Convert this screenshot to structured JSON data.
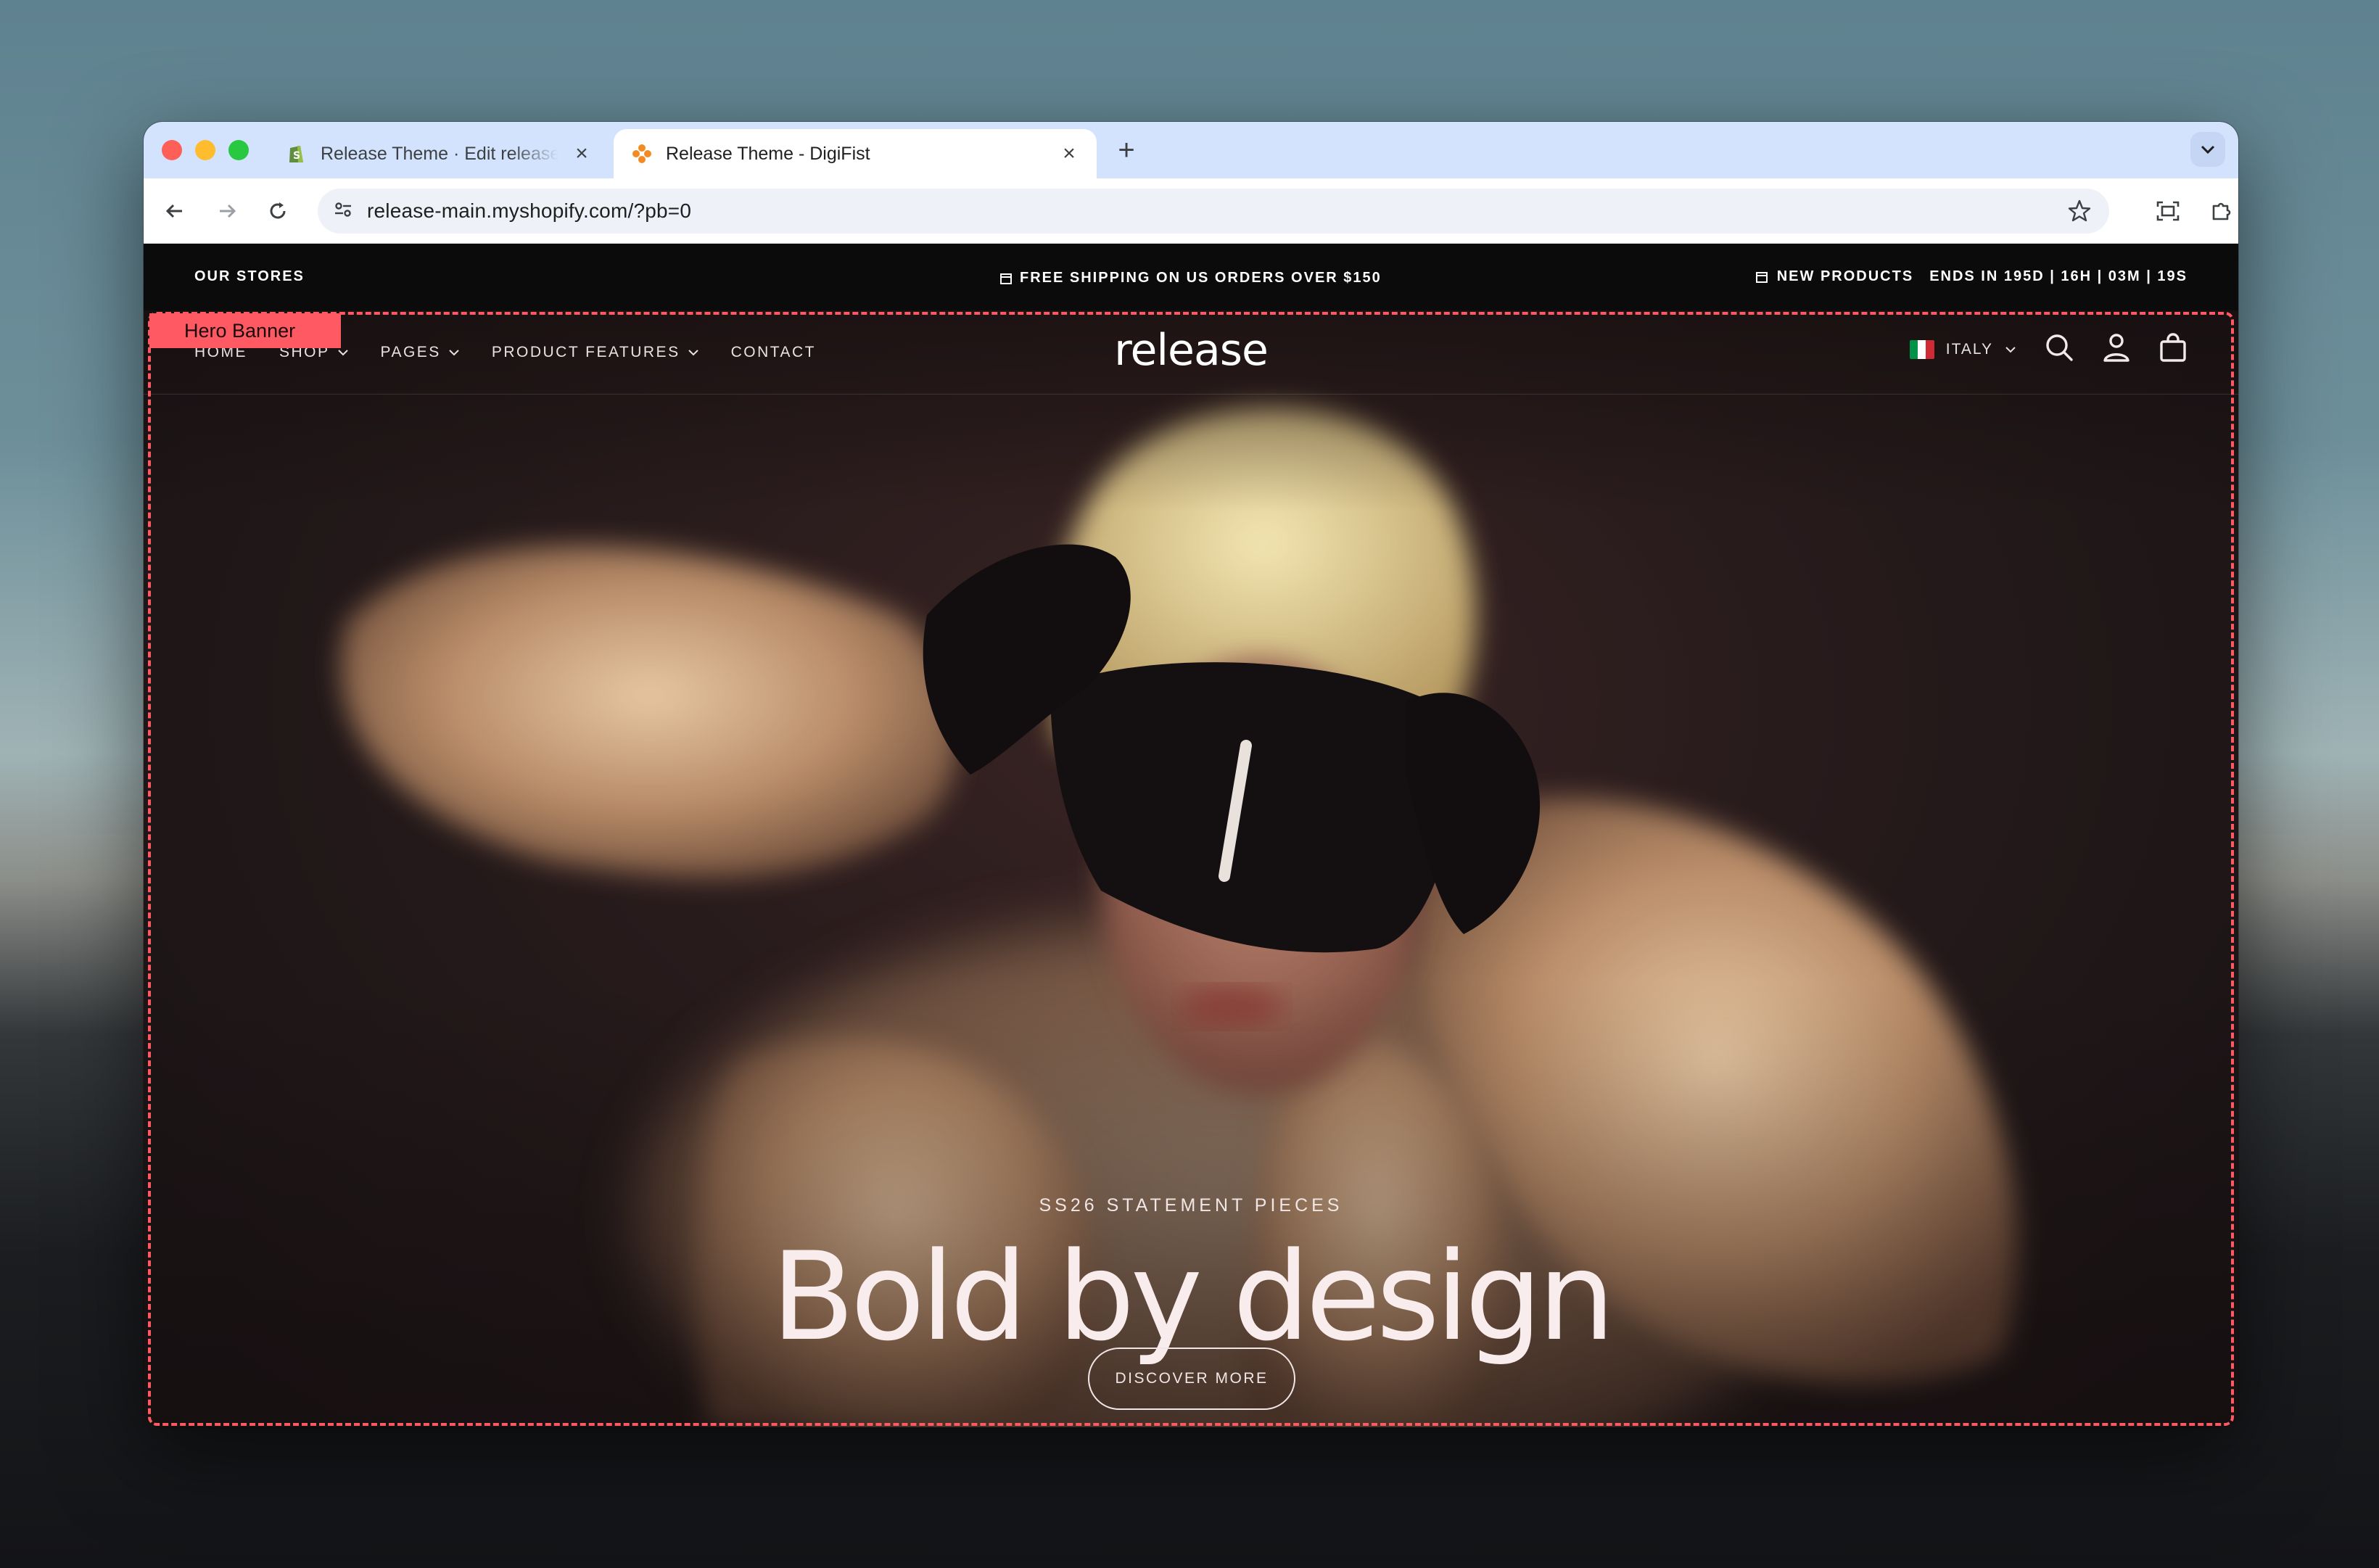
{
  "browser": {
    "tabs": [
      {
        "title": "Release Theme · Edit release",
        "active": false,
        "close": "×",
        "icon": "shopify-icon"
      },
      {
        "title": "Release Theme - DigiFist",
        "active": true,
        "close": "×",
        "icon": "digifist-icon"
      }
    ],
    "new_tab": "+",
    "url": "release-main.myshopify.com/?pb=0"
  },
  "announcement": {
    "left": "OUR STORES",
    "center": "FREE SHIPPING ON US ORDERS OVER $150",
    "right_label": "NEW PRODUCTS",
    "countdown": "ENDS IN 195D | 16H | 03M | 19S"
  },
  "header": {
    "menu": [
      {
        "label": "HOME",
        "dropdown": false
      },
      {
        "label": "SHOP",
        "dropdown": true
      },
      {
        "label": "PAGES",
        "dropdown": true
      },
      {
        "label": "PRODUCT FEATURES",
        "dropdown": true
      },
      {
        "label": "CONTACT",
        "dropdown": false
      }
    ],
    "logo": "release",
    "country": "ITALY",
    "icons": [
      "search-icon",
      "account-icon",
      "cart-icon"
    ]
  },
  "hero": {
    "eyebrow": "SS26 STATEMENT PIECES",
    "title": "Bold by design",
    "cta": "DISCOVER MORE"
  },
  "editor": {
    "section_label": "Hero Banner",
    "outline_color": "#ff5a64"
  },
  "colors": {
    "accent": "#ff5a64",
    "tab_strip": "#d3e3fd",
    "hero_bg": "#2a1c1d"
  }
}
